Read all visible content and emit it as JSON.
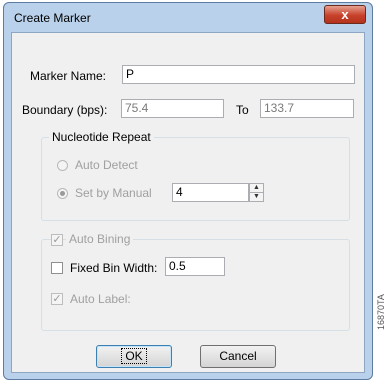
{
  "window": {
    "title": "Create Marker"
  },
  "marker_name": {
    "label": "Marker Name:",
    "value": "P"
  },
  "boundary": {
    "label": "Boundary (bps):",
    "from_value": "75.4",
    "to_label": "To",
    "to_value": "133.7"
  },
  "nucleotide_repeat": {
    "title": "Nucleotide Repeat",
    "auto_detect_label": "Auto Detect",
    "set_by_manual_label": "Set by Manual",
    "manual_value": "4"
  },
  "binning": {
    "auto_bining_label": "Auto Bining",
    "fixed_bin_width_label": "Fixed Bin Width:",
    "fixed_bin_width_value": "0.5",
    "auto_label_label": "Auto Label:",
    "check_mark": "✓"
  },
  "buttons": {
    "ok": "OK",
    "cancel": "Cancel"
  },
  "close_glyph": "x",
  "figure_code": "16870TA"
}
